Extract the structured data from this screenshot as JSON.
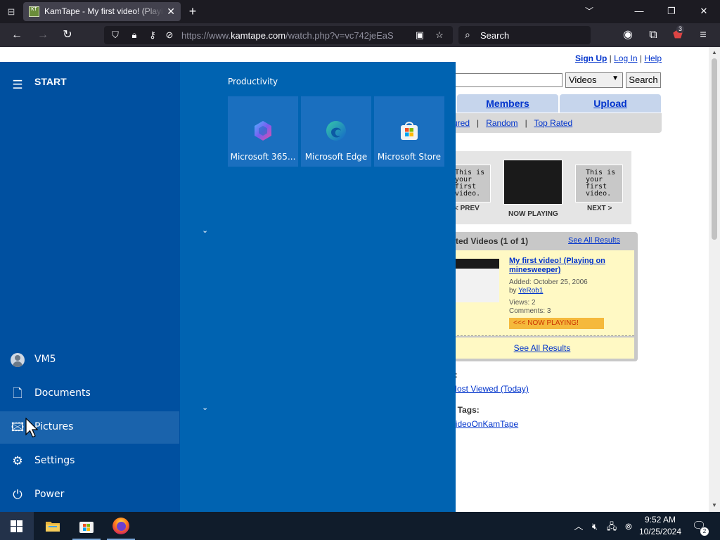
{
  "browser": {
    "tab_title": "KamTape - My first video! (Playing on minesweeper)",
    "tab_favicon_text": "KT",
    "url_prefix": "https://www.",
    "url_host": "kamtape.com",
    "url_path": "/watch.php?v=vc742jeEaS",
    "search_placeholder": "Search",
    "extension_badge": "3"
  },
  "site": {
    "links": {
      "signup": "Sign Up",
      "sep": "|",
      "login": "Log In",
      "help": "Help"
    },
    "search_select": "Videos",
    "search_button": "Search",
    "tabs": [
      "Members",
      "Upload"
    ],
    "subnav": {
      "featured_fragment": "ured",
      "random": "Random",
      "top_rated": "Top Rated",
      "sep": "|"
    },
    "prev_thumb_text": "This is your first video.",
    "next_thumb_text": "This is your first video.",
    "prev_label": "< PREV",
    "now_label": "NOW PLAYING",
    "next_label": "NEXT >",
    "related": {
      "header_fragment": "ted Videos (1 of 1)",
      "see_all_results": "See All Results",
      "item_title": "My first video! (Playing on minesweeper)",
      "added": "Added: October 25, 2006",
      "by_prefix": "by",
      "author": "YeRob1",
      "views": "Views: 2",
      "comments": "Comments: 3",
      "now_playing": "<<< NOW PLAYING!",
      "footer_link": "See All Results"
    },
    "frag_s": "s:",
    "most_viewed_fragment": "Most Viewed (Today)",
    "tags_fragment": "d Tags:",
    "tag_link_fragment": "VideoOnKamTape"
  },
  "start_menu": {
    "header": "START",
    "user": "VM5",
    "items": [
      {
        "label": "Documents",
        "icon": "document-icon"
      },
      {
        "label": "Pictures",
        "icon": "pictures-icon"
      },
      {
        "label": "Settings",
        "icon": "settings-icon"
      },
      {
        "label": "Power",
        "icon": "power-icon"
      }
    ],
    "group_title": "Productivity",
    "tiles": [
      {
        "label": "Microsoft 365...",
        "icon": "microsoft-365-icon"
      },
      {
        "label": "Microsoft Edge",
        "icon": "edge-icon"
      },
      {
        "label": "Microsoft Store",
        "icon": "store-icon"
      }
    ]
  },
  "taskbar": {
    "time": "9:52 AM",
    "date": "10/25/2024",
    "notifications": "2",
    "apps": [
      "file-explorer-icon",
      "microsoft-store-icon",
      "firefox-icon"
    ]
  },
  "colors": {
    "start_menu_bg": "#0063b1",
    "start_left_bg": "#0050a0",
    "taskbar_bg": "#101c2b",
    "link_blue": "#0033cc"
  }
}
